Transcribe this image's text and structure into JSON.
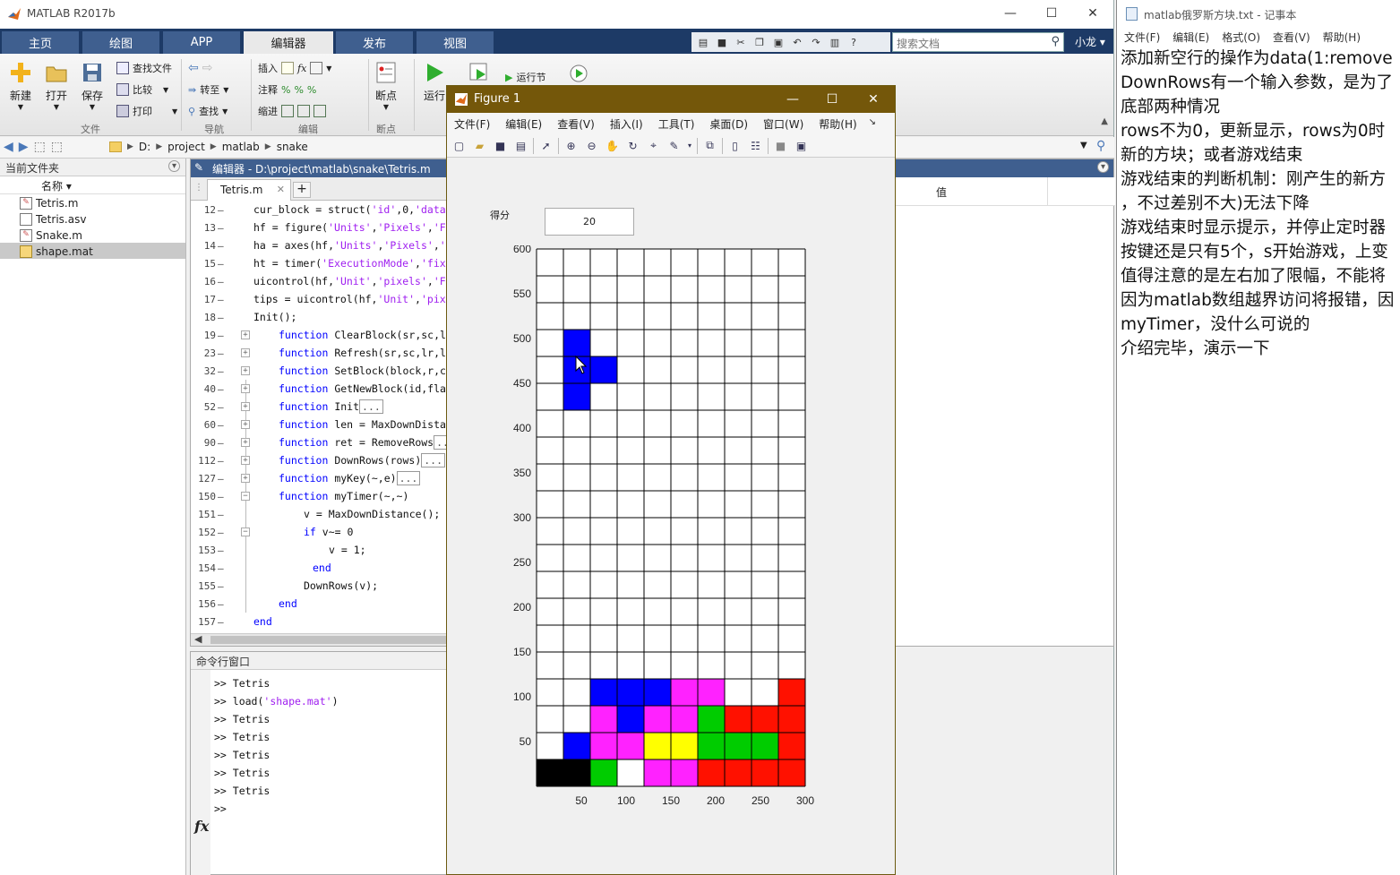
{
  "matlab": {
    "title": "MATLAB R2017b",
    "tabs": [
      "主页",
      "绘图",
      "APP",
      "编辑器",
      "发布",
      "视图"
    ],
    "active_tab": "编辑器",
    "search_placeholder": "搜索文档",
    "user": "小龙 ▾",
    "ribbon": {
      "new": "新建",
      "open": "打开",
      "save": "保存",
      "find_files": "查找文件",
      "compare": "比较",
      "print": "打印",
      "goto": "转至",
      "find": "查找",
      "insert": "插入",
      "comment": "注释",
      "indent": "缩进",
      "breakpoint": "断点",
      "run": "运行",
      "run_section": "运行节",
      "groups": [
        "文件",
        "导航",
        "编辑",
        "断点"
      ]
    },
    "path": [
      "D:",
      "project",
      "matlab",
      "snake"
    ],
    "current_folder": {
      "header": "当前文件夹",
      "col_name": "名称 ▾",
      "files": [
        "Tetris.m",
        "Tetris.asv",
        "Snake.m",
        "shape.mat"
      ],
      "selected": "shape.mat"
    },
    "editor": {
      "title": "编辑器 - D:\\project\\matlab\\snake\\Tetris.m",
      "tab": "Tetris.m",
      "lines": [
        {
          "n": "12",
          "t": "cur_block = struct('id',0,'data"
        },
        {
          "n": "13",
          "t": "hf = figure('Units','Pixels','F"
        },
        {
          "n": "14",
          "t": "ha = axes(hf,'Units','Pixels','"
        },
        {
          "n": "15",
          "t": "ht = timer('ExecutionMode','fix"
        },
        {
          "n": "16",
          "t": "uicontrol(hf,'Unit','pixels','F"
        },
        {
          "n": "17",
          "t": "tips = uicontrol(hf,'Unit','pix"
        },
        {
          "n": "18",
          "t": "Init();"
        },
        {
          "n": "19",
          "t": "function ClearBlock(sr,sc,l"
        },
        {
          "n": "23",
          "t": "function Refresh(sr,sc,lr,l"
        },
        {
          "n": "32",
          "t": "function SetBlock(block,r,c"
        },
        {
          "n": "40",
          "t": "function GetNewBlock(id,fla"
        },
        {
          "n": "52",
          "t": "function Init"
        },
        {
          "n": "60",
          "t": "function len = MaxDownDista"
        },
        {
          "n": "90",
          "t": "function ret = RemoveRows"
        },
        {
          "n": "112",
          "t": "function DownRows(rows)"
        },
        {
          "n": "127",
          "t": "function myKey(~,e)"
        },
        {
          "n": "150",
          "t": "function myTimer(~,~)"
        },
        {
          "n": "151",
          "t": "v = MaxDownDistance();"
        },
        {
          "n": "152",
          "t": "if v~= 0"
        },
        {
          "n": "153",
          "t": "v = 1;"
        },
        {
          "n": "154",
          "t": "end"
        },
        {
          "n": "155",
          "t": "DownRows(v);"
        },
        {
          "n": "156",
          "t": "end"
        },
        {
          "n": "157",
          "t": "end"
        }
      ],
      "ellipsis": "..."
    },
    "workspace": {
      "value_col": "值"
    },
    "command_window": {
      "header": "命令行窗口",
      "history": [
        ">> Tetris",
        ">> load('shape.mat')",
        ">> Tetris",
        ">> Tetris",
        ">> Tetris",
        ">> Tetris",
        ">> Tetris"
      ],
      "prompt": ">>",
      "fx": "fx"
    }
  },
  "figure": {
    "title": "Figure 1",
    "menu": [
      "文件(F)",
      "编辑(E)",
      "查看(V)",
      "插入(I)",
      "工具(T)",
      "桌面(D)",
      "窗口(W)",
      "帮助(H)"
    ],
    "score_label": "得分",
    "score_value": "20",
    "board": {
      "cols": 10,
      "rows": 20,
      "cell_units": 30,
      "y_ticks": [
        "600",
        "550",
        "500",
        "450",
        "400",
        "350",
        "300",
        "250",
        "200",
        "150",
        "100",
        "50"
      ],
      "x_ticks": [
        "50",
        "100",
        "150",
        "200",
        "250",
        "300"
      ],
      "palette": {
        "B": "#0000ff",
        "M": "#ff22ff",
        "Y": "#ffff00",
        "G": "#00cc00",
        "R": "#ff1100",
        "K": "#000000",
        "W": "#ffffff"
      },
      "grid_top_to_bottom": [
        "..........",
        "..........",
        "..........",
        ".B........",
        ".BB.......",
        ".B........",
        "..........",
        "..........",
        "..........",
        "..........",
        "..........",
        "..........",
        "..........",
        "..........",
        "..........",
        "..........",
        "..BBBMM..R",
        "..MBMMGRRR",
        ".BMMYYGGGR",
        "KKGWMMRRRR"
      ]
    }
  },
  "notepad": {
    "title": "matlab俄罗斯方块.txt - 记事本",
    "menu": [
      "文件(F)",
      "编辑(E)",
      "格式(O)",
      "查看(V)",
      "帮助(H)"
    ],
    "lines": [
      "添加新空行的操作为data(1:remove",
      "DownRows有一个输入参数，是为了",
      "底部两种情况",
      "rows不为0，更新显示，rows为0时",
      "新的方块；或者游戏结束",
      "游戏结束的判断机制：刚产生的新方",
      "，不过差别不大)无法下降",
      "游戏结束时显示提示，并停止定时器",
      "按键还是只有5个，s开始游戏，上变",
      "值得注意的是左右加了限幅，不能将",
      "因为matlab数组越界访问将报错，因",
      "myTimer，没什么可说的",
      "介绍完毕，演示一下"
    ]
  }
}
